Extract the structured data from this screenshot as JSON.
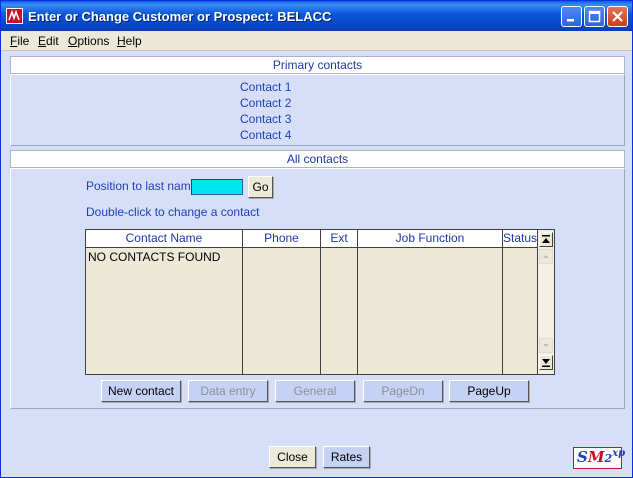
{
  "window": {
    "title": "Enter or Change Customer or Prospect: BELACC"
  },
  "menu": {
    "items": [
      {
        "first": "F",
        "rest": "ile"
      },
      {
        "first": "E",
        "rest": "dit"
      },
      {
        "first": "O",
        "rest": "ptions"
      },
      {
        "first": "H",
        "rest": "elp"
      }
    ]
  },
  "primary": {
    "header": "Primary contacts",
    "contacts": [
      "Contact 1",
      "Contact 2",
      "Contact 3",
      "Contact 4"
    ]
  },
  "all": {
    "header": "All contacts",
    "position_label": "Position to last name",
    "position_value": "",
    "go_label": "Go",
    "hint": "Double-click to change a contact"
  },
  "grid": {
    "columns": [
      "Contact Name",
      "Phone",
      "Ext",
      "Job Function",
      "Status"
    ],
    "message": "NO CONTACTS FOUND"
  },
  "actions": {
    "new_contact": "New contact",
    "data_entry": "Data entry",
    "general": "General",
    "page_dn": "PageDn",
    "page_up": "PageUp"
  },
  "footer": {
    "close": "Close",
    "rates": "Rates"
  },
  "logo": {
    "part1": "S",
    "part2": "M",
    "part3": "2",
    "part4": "xp"
  },
  "colors": {
    "titlebar": "#0a54d8",
    "client_bg": "#d6dff7",
    "link_blue": "#1d3fbf",
    "input_cyan": "#00e5ee"
  },
  "icons": {
    "app": "sm2-app-icon",
    "minimize": "minimize-icon",
    "maximize": "maximize-icon",
    "close": "close-icon",
    "scroll_top": "scroll-top-icon",
    "scroll_up": "scroll-up-icon",
    "scroll_down": "scroll-down-icon",
    "scroll_bottom": "scroll-bottom-icon"
  }
}
